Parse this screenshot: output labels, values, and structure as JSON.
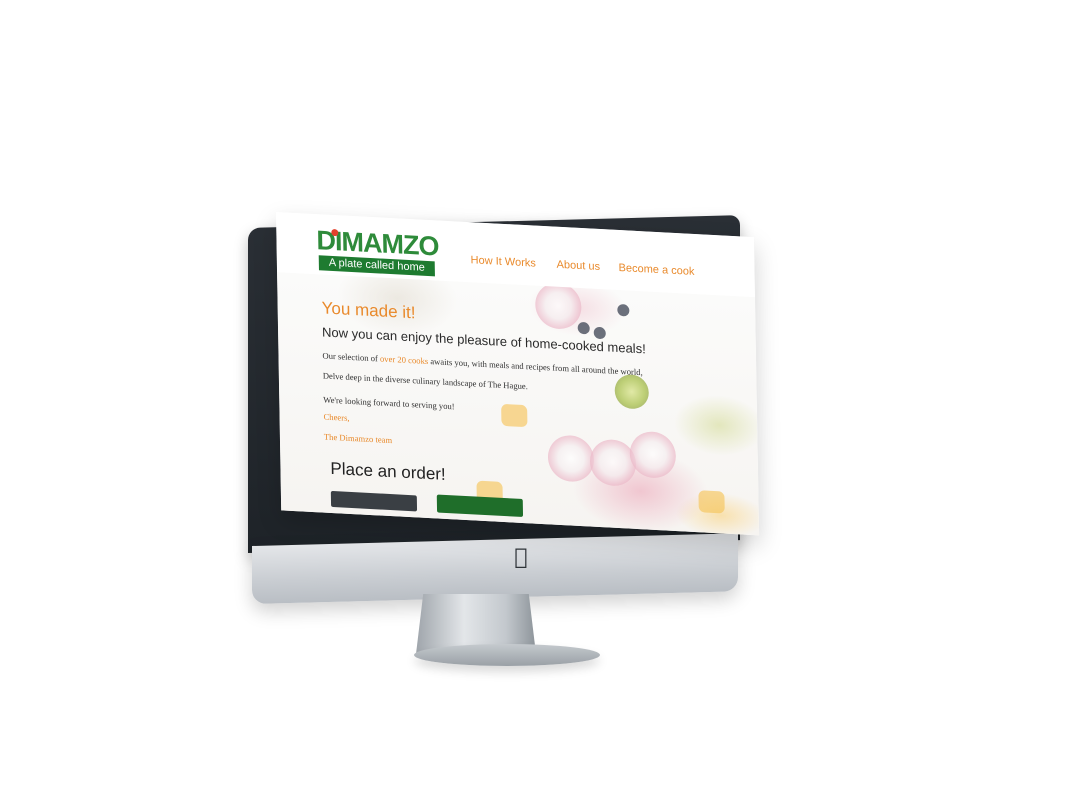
{
  "brand": {
    "name": "DIMAMZO",
    "tagline": "A plate called home",
    "colors": {
      "green": "#2e8b3a",
      "dark_green": "#1e7b30",
      "orange": "#e98a2c",
      "red": "#e4402c"
    }
  },
  "nav": {
    "links": [
      {
        "label": "How It Works"
      },
      {
        "label": "About us"
      },
      {
        "label": "Become a cook"
      }
    ]
  },
  "hero": {
    "headline": "You made it!",
    "subheadline": "Now you can enjoy the pleasure of home-cooked meals!",
    "para1_prefix": "Our selection of ",
    "para1_highlight": "over 20 cooks",
    "para1_suffix": " awaits you, with meals and recipes from all around the world,",
    "para2": "Delve deep in the diverse culinary landscape of The Hague.",
    "para3": "We're looking forward to serving you!",
    "signoff": "Cheers,",
    "signature": "The Dimamzo team"
  },
  "order": {
    "heading": "Place an order!"
  },
  "device": {
    "logo_icon": "apple-logo-icon"
  }
}
